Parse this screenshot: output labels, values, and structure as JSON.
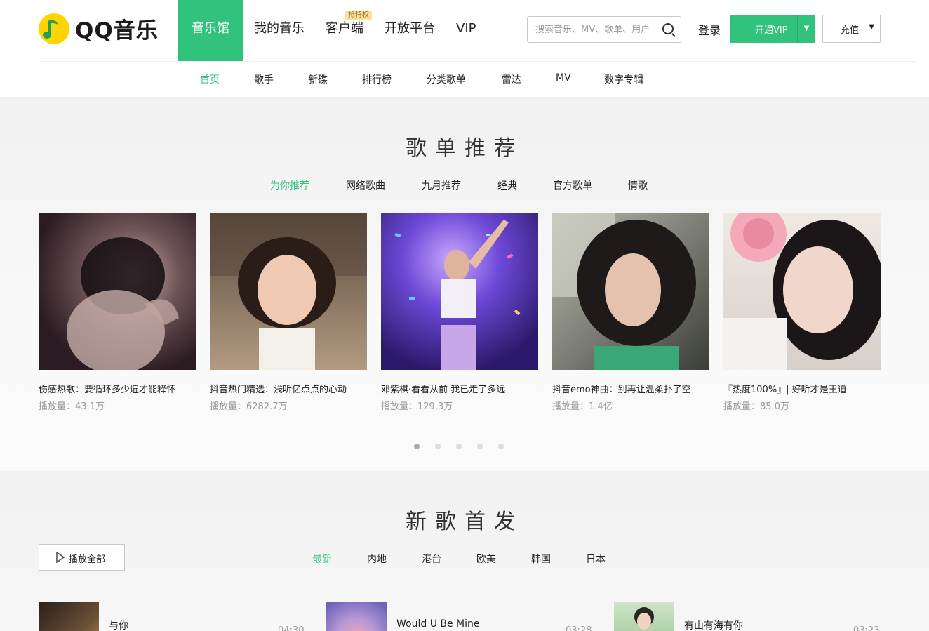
{
  "brand": {
    "name": "QQ音乐"
  },
  "main_nav": [
    {
      "label": "音乐馆",
      "active": true
    },
    {
      "label": "我的音乐"
    },
    {
      "label": "客户端",
      "badge": "抢特权"
    },
    {
      "label": "开放平台"
    },
    {
      "label": "VIP"
    }
  ],
  "search": {
    "placeholder": "搜索音乐、MV、歌单、用户"
  },
  "account": {
    "login": "登录",
    "vip_button": "开通VIP",
    "charge_button": "充值"
  },
  "sub_nav": [
    {
      "label": "首页",
      "active": true
    },
    {
      "label": "歌手"
    },
    {
      "label": "新碟"
    },
    {
      "label": "排行榜"
    },
    {
      "label": "分类歌单"
    },
    {
      "label": "雷达"
    },
    {
      "label": "MV"
    },
    {
      "label": "数字专辑"
    }
  ],
  "playlist_section": {
    "title": "歌单推荐",
    "tabs": [
      {
        "label": "为你推荐",
        "active": true
      },
      {
        "label": "网络歌曲"
      },
      {
        "label": "九月推荐"
      },
      {
        "label": "经典"
      },
      {
        "label": "官方歌单"
      },
      {
        "label": "情歌"
      }
    ],
    "cards": [
      {
        "title": "伤感热歌：要循环多少遍才能释怀",
        "plays_label": "播放量：",
        "plays": "43.1万",
        "theme": "#3a2a2e"
      },
      {
        "title": "抖音热门精选：浅听亿点点的心动",
        "plays_label": "播放量：",
        "plays": "6282.7万",
        "theme": "#6b5a4a"
      },
      {
        "title": "邓紫棋·看看从前 我已走了多远",
        "plays_label": "播放量：",
        "plays": "129.3万",
        "theme": "#4a3f9a"
      },
      {
        "title": "抖音emo神曲：别再让温柔扑了空",
        "plays_label": "播放量：",
        "plays": "1.4亿",
        "theme": "#8a8d84"
      },
      {
        "title": "『热度100%』| 好听才是王道",
        "plays_label": "播放量：",
        "plays": "85.0万",
        "theme": "#dcd3cc"
      }
    ],
    "pager_total": 5,
    "pager_active": 1
  },
  "new_songs_section": {
    "title": "新歌首发",
    "play_all": "播放全部",
    "tabs": [
      {
        "label": "最新",
        "active": true
      },
      {
        "label": "内地"
      },
      {
        "label": "港台"
      },
      {
        "label": "欧美"
      },
      {
        "label": "韩国"
      },
      {
        "label": "日本"
      }
    ],
    "songs": [
      {
        "name": "与你",
        "duration": "04:30",
        "theme": "#5a4632"
      },
      {
        "name": "Would U Be Mine",
        "duration": "03:28",
        "theme": "#8a82c8"
      },
      {
        "name": "有山有海有你",
        "duration": "03:23",
        "theme": "#a9cfa2"
      }
    ]
  },
  "colors": {
    "accent": "#31c27c",
    "text": "#222222",
    "muted": "#999999",
    "badge_bg": "#f9e29c"
  }
}
